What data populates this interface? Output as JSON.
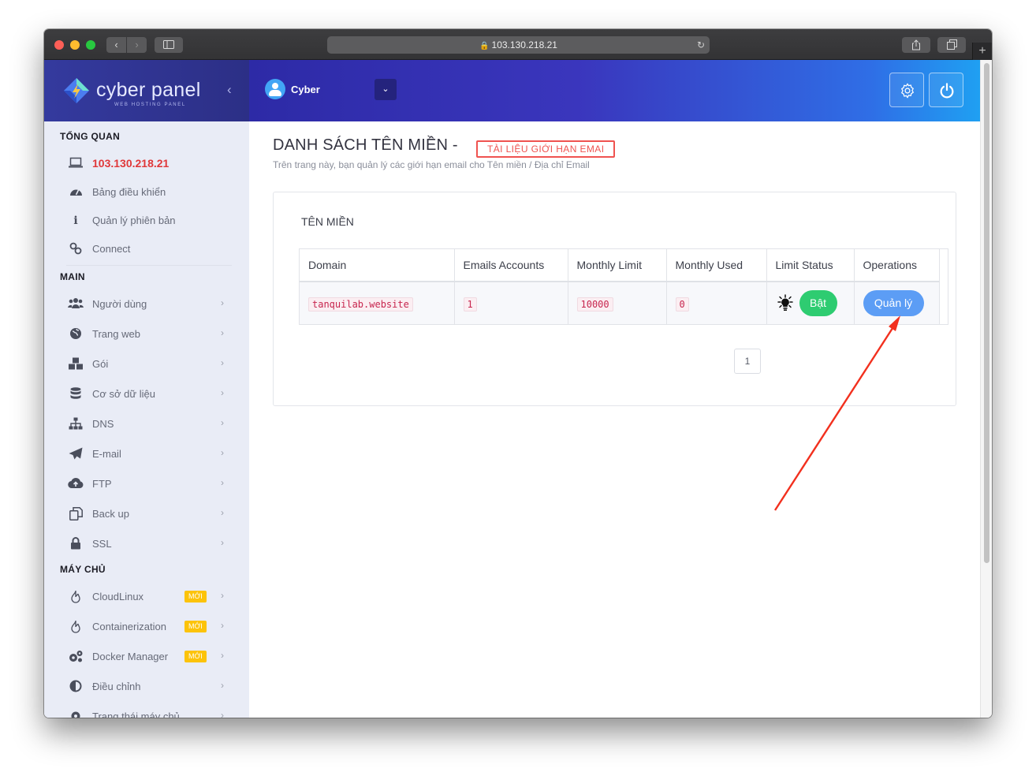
{
  "browser": {
    "url": "103.130.218.21",
    "back_icon": "chevron-left-icon",
    "forward_icon": "chevron-right-icon",
    "sidebar_icon": "sidebar-icon",
    "reload_icon": "reload-icon",
    "share_icon": "share-icon",
    "tabs_icon": "tabs-icon",
    "new_tab_icon": "plus-icon"
  },
  "brand": {
    "name": "cyber panel",
    "subtitle": "WEB HOSTING PANEL",
    "collapse_icon": "chevron-left-icon"
  },
  "topbar": {
    "user_name": "Cyber",
    "dropdown_icon": "chevron-down-icon",
    "settings_icon": "gear-icon",
    "power_icon": "power-icon"
  },
  "sidebar": {
    "section_overview": "TỔNG QUAN",
    "overview_items": [
      {
        "label": "103.130.218.21",
        "icon": "laptop-icon",
        "active": true
      },
      {
        "label": "Bảng điều khiển",
        "icon": "dashboard-icon"
      },
      {
        "label": "Quản lý phiên bản",
        "icon": "info-icon"
      },
      {
        "label": "Connect",
        "icon": "link-icon"
      }
    ],
    "section_main": "MAIN",
    "main_items": [
      {
        "label": "Người dùng",
        "icon": "users-icon"
      },
      {
        "label": "Trang web",
        "icon": "globe-icon"
      },
      {
        "label": "Gói",
        "icon": "cubes-icon"
      },
      {
        "label": "Cơ sở dữ liệu",
        "icon": "database-icon"
      },
      {
        "label": "DNS",
        "icon": "sitemap-icon"
      },
      {
        "label": "E-mail",
        "icon": "paper-plane-icon"
      },
      {
        "label": "FTP",
        "icon": "cloud-upload-icon"
      },
      {
        "label": "Back up",
        "icon": "copy-icon"
      },
      {
        "label": "SSL",
        "icon": "lock-icon"
      }
    ],
    "section_server": "MÁY CHỦ",
    "server_items": [
      {
        "label": "CloudLinux",
        "icon": "fire-icon",
        "badge": "MỚI"
      },
      {
        "label": "Containerization",
        "icon": "fire-icon",
        "badge": "MỚI"
      },
      {
        "label": "Docker Manager",
        "icon": "cogs-icon",
        "badge": "MỚI"
      },
      {
        "label": "Điều chỉnh",
        "icon": "adjust-icon"
      },
      {
        "label": "Trạng thái máy chủ",
        "icon": "gear-icon"
      }
    ],
    "chevron_icon": "chevron-right-icon"
  },
  "main": {
    "title": "DANH SÁCH TÊN MIỀN -",
    "doc_link": "TÀI LIỆU GIỚI HẠN EMAI",
    "description": "Trên trang này, bạn quản lý các giới hạn email cho Tên miền / Địa chỉ Email",
    "card_title": "TÊN MIỀN",
    "table": {
      "headers": [
        "Domain",
        "Emails Accounts",
        "Monthly Limit",
        "Monthly Used",
        "Limit Status",
        "Operations"
      ],
      "rows": [
        {
          "domain": "tanquilab.website",
          "emails_accounts": "1",
          "monthly_limit": "10000",
          "monthly_used": "0",
          "status_icon": "lightbulb-icon",
          "status_button": "Bật",
          "operation_button": "Quản lý"
        }
      ]
    },
    "pagination": [
      "1"
    ]
  },
  "colors": {
    "accent_red": "#e0383a",
    "status_on_green": "#2ecc71",
    "manage_blue": "#5c9df5",
    "annotation_arrow": "#f2301e",
    "topbar_start": "#2d2aa6",
    "topbar_end": "#1fa0f2"
  }
}
